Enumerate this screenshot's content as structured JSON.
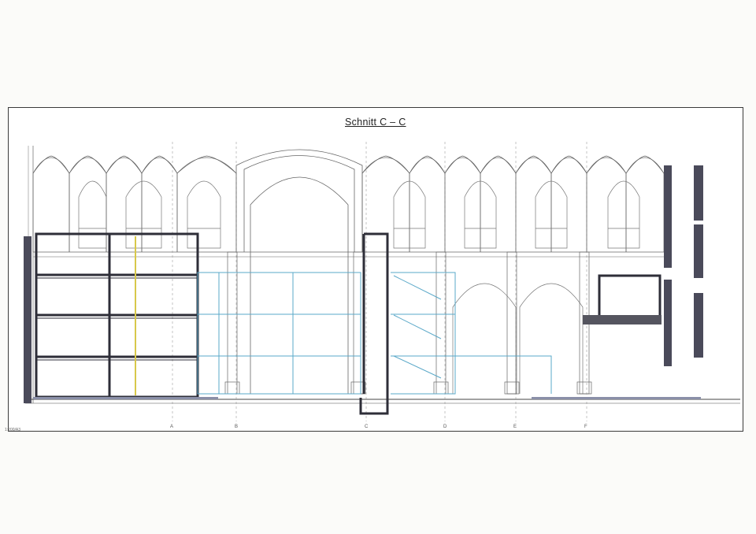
{
  "drawing": {
    "title": "Schnitt C – C",
    "axis_labels": [
      "A",
      "B",
      "C",
      "D",
      "E",
      "F"
    ],
    "corner_note": "1:200/A3",
    "colors": {
      "line": "#555555",
      "dark": "#3c3c48",
      "blue": "#5aa8c8",
      "yellow": "#d8c84a",
      "wall": "#4a4a5a"
    }
  }
}
